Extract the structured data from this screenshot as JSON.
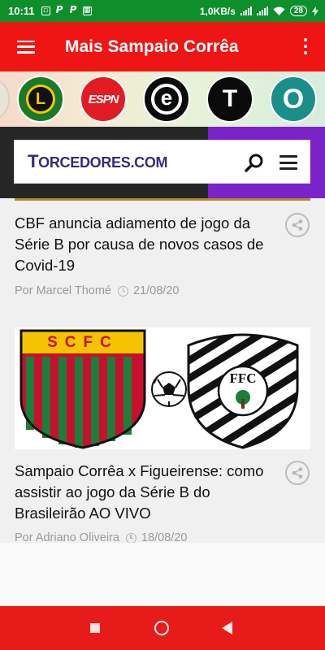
{
  "status_bar": {
    "time": "10:11",
    "notif_icons": [
      "image-icon",
      "p-icon",
      "p-icon",
      "grid-icon"
    ],
    "net_speed": "1,0KB/s",
    "battery": "28"
  },
  "app_bar": {
    "title": "Mais Sampaio Corrêa",
    "color": "#ef1515"
  },
  "channels": [
    {
      "name": "lance-channel-icon",
      "label": "L",
      "bg": "#1a7a2a"
    },
    {
      "name": "espn-channel-icon",
      "label": "ESPN",
      "bg": "#e31b23"
    },
    {
      "name": "e-channel-icon",
      "label": "e",
      "bg": "#0b0b0b"
    },
    {
      "name": "t-channel-icon",
      "label": "T",
      "bg": "#0b0b0b"
    },
    {
      "name": "o-channel-icon",
      "label": "O",
      "bg": "#1a8f8a"
    }
  ],
  "banner": {
    "brand_first": "T",
    "brand_rest": "ORCEDORES.COM"
  },
  "feed": {
    "articles": [
      {
        "title": "CBF anuncia adiamento de jogo da Série B por causa de novos casos de Covid-19",
        "author": "Por Marcel Thomé",
        "date": "21/08/20"
      },
      {
        "title": "Sampaio Corrêa x Figueirense: como assistir ao jogo da Série B do Brasileirão AO VIVO",
        "author": "Por Adriano Oliveira",
        "date": "18/08/20",
        "image_left_letters": "SCFC",
        "image_right_letters": "FFC"
      }
    ]
  },
  "nav_bar": {
    "color": "#e81b1b"
  }
}
